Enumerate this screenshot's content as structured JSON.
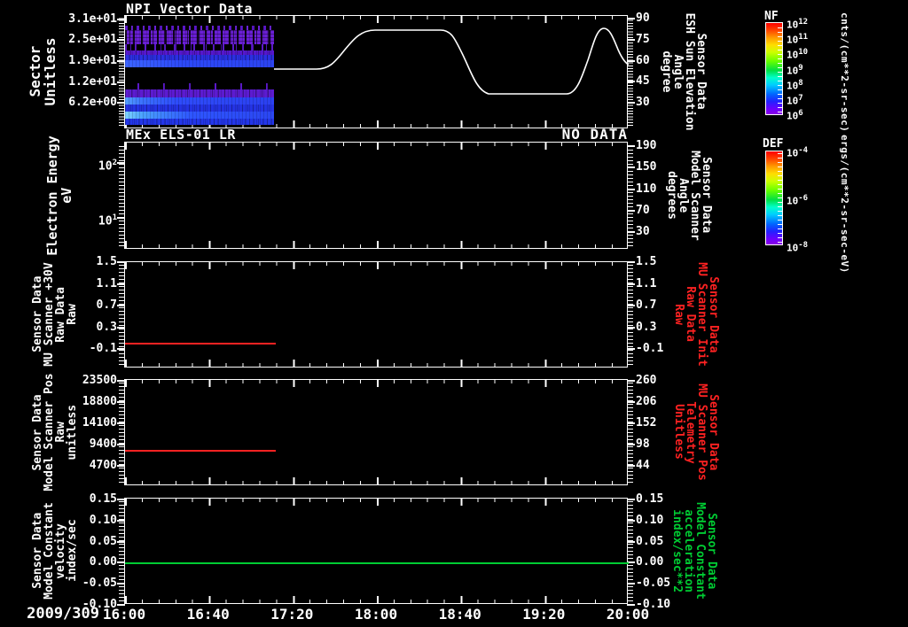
{
  "date_label": "2009/309",
  "time_ticks": [
    "16:00",
    "16:40",
    "17:20",
    "18:00",
    "18:40",
    "19:20",
    "20:00"
  ],
  "colors": {
    "axis": "#ffffff",
    "red_series": "#ff2222",
    "green_series": "#00cc33",
    "spectro_purple": "#6a1fd6",
    "spectro_blue": "#2c48f8",
    "spectro_cyan": "#7fd4ff"
  },
  "panels": [
    {
      "title": "NPI Vector Data",
      "left_label_lines": [
        "Sector",
        "Unitless"
      ],
      "left_ticks": [
        "3.1e+01",
        "2.5e+01",
        "1.9e+01",
        "1.2e+01",
        "6.2e+00"
      ],
      "right_ticks": [
        "90",
        "75",
        "60",
        "45",
        "30"
      ],
      "right_label_lines": [
        "Sensor Data",
        "ESH Sun Elevation",
        "Angle",
        "degree"
      ]
    },
    {
      "title": "MEx ELS-01 LR",
      "no_data": "NO DATA",
      "left_label_lines": [
        "Electron Energy",
        "eV"
      ],
      "left_ticks": [
        "10^2",
        "10^1"
      ],
      "right_ticks": [
        "190",
        "150",
        "110",
        "70",
        "30"
      ],
      "right_label_lines": [
        "Sensor Data",
        "Model Scanner",
        "Angle",
        "degrees"
      ]
    },
    {
      "left_label_lines": [
        "Sensor Data",
        "MU Scanner +30V",
        "Raw Data",
        "Raw"
      ],
      "left_ticks": [
        "1.5",
        "1.1",
        "0.7",
        "0.3",
        "-0.1"
      ],
      "right_ticks": [
        "1.5",
        "1.1",
        "0.7",
        "0.3",
        "-0.1"
      ],
      "right_label_lines": [
        "Sensor Data",
        "MU Scanner Init",
        "Raw Data",
        "Raw"
      ]
    },
    {
      "left_label_lines": [
        "Sensor Data",
        "Model Scanner Pos",
        "Raw",
        "unitless"
      ],
      "left_ticks": [
        "23500",
        "18800",
        "14100",
        "9400",
        "4700"
      ],
      "right_ticks": [
        "260",
        "206",
        "152",
        "98",
        "44"
      ],
      "right_label_lines": [
        "Sensor Data",
        "MU Scanner Pos",
        "Telemetry",
        "Unitless"
      ]
    },
    {
      "left_label_lines": [
        "Sensor Data",
        "Model Constant",
        "velocity",
        "index/sec"
      ],
      "left_ticks": [
        "0.15",
        "0.10",
        "0.05",
        "0.00",
        "-0.05",
        "-0.10"
      ],
      "right_ticks": [
        "0.15",
        "0.10",
        "0.05",
        "0.00",
        "-0.05",
        "-0.10"
      ],
      "right_label_lines": [
        "Sensor Data",
        "Model Constant",
        "acceleration",
        "index/sec**2"
      ]
    }
  ],
  "colorbars": [
    {
      "title": "NF",
      "ticks": [
        "10^12",
        "10^11",
        "10^10",
        "10^9",
        "10^8",
        "10^7",
        "10^6"
      ],
      "units": "cnts/(cm**2-sr-sec)"
    },
    {
      "title": "DEF",
      "ticks": [
        "10^-4",
        "10^-6",
        "10^-8"
      ],
      "units": "ergs/(cm**2-sr-sec-eV)"
    }
  ],
  "chart_data": [
    {
      "type": "heatmap",
      "title": "NPI Vector Data",
      "ylabel": "Sector (Unitless)",
      "y_ticks": [
        31,
        25,
        19,
        12,
        6.2
      ],
      "x_start": "16:00",
      "x_end_of_data": "17:11",
      "intensity_units": "cnts/(cm**2-sr-sec)",
      "intensity_range": [
        1000000.0,
        1000000000000.0
      ],
      "bands": [
        {
          "sectors": "24-27",
          "appearance": "purple, speckled with black dropouts"
        },
        {
          "sectors": "19-23",
          "appearance": "purple to bright blue gradient"
        },
        {
          "sectors": "13-18",
          "appearance": "black (no counts)"
        },
        {
          "sectors": "10-12",
          "appearance": "purple with sparse spikes"
        },
        {
          "sectors": "0-9",
          "appearance": "blue with brighter cyan patches at left"
        }
      ]
    },
    {
      "type": "line",
      "name": "Sensor Data ESH Sun Elevation Angle (degree)",
      "color": "#ffffff",
      "ylim": [
        20,
        90
      ],
      "x_hours": [
        17.18,
        17.52,
        17.99,
        18.51,
        18.89,
        19.51,
        19.8,
        20.0
      ],
      "y_degrees": [
        56,
        56,
        79,
        79,
        38,
        38,
        79,
        57
      ]
    },
    {
      "type": "heatmap",
      "title": "MEx ELS-01 LR",
      "ylabel": "Electron Energy (eV)",
      "y_scale": "log",
      "y_ticks": [
        100,
        10
      ],
      "status": "NO DATA",
      "intensity_units": "ergs/(cm**2-sr-sec-eV)",
      "intensity_range": [
        1e-08,
        0.0001
      ]
    },
    {
      "type": "line",
      "name": "Sensor Data MU Scanner +30V Raw Data Raw",
      "color": "#ff2222",
      "ylim": [
        -0.1,
        1.5
      ],
      "x_hours": [
        16.0,
        17.18
      ],
      "y_values": [
        0.0,
        0.0
      ]
    },
    {
      "type": "line",
      "name": "Sensor Data Model Scanner Pos Raw (unitless)",
      "color": "#ff2222",
      "ylim": [
        0,
        23500
      ],
      "x_hours": [
        16.0,
        17.18
      ],
      "y_values": [
        8200,
        8200
      ]
    },
    {
      "type": "line",
      "name": "Sensor Data Model Constant velocity (index/sec)",
      "color": "#00cc33",
      "ylim": [
        -0.1,
        0.15
      ],
      "x_hours": [
        16.0,
        20.0
      ],
      "y_values": [
        0.0,
        0.0
      ]
    }
  ]
}
